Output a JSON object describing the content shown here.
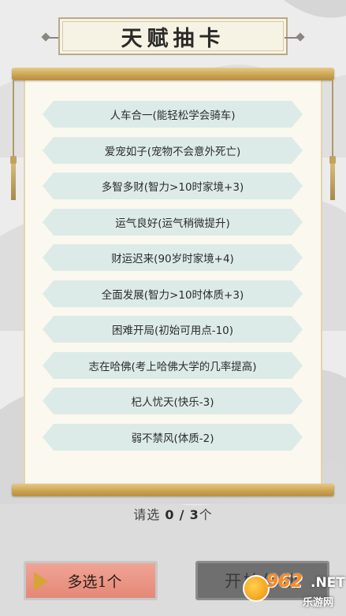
{
  "title": "天赋抽卡",
  "talents": [
    {
      "label": "人车合一(能轻松学会骑车)"
    },
    {
      "label": "爱宠如子(宠物不会意外死亡)"
    },
    {
      "label": "多智多财(智力>10时家境+3)"
    },
    {
      "label": "运气良好(运气稍微提升)"
    },
    {
      "label": "财运迟来(90岁时家境+4)"
    },
    {
      "label": "全面发展(智力>10时体质+3)"
    },
    {
      "label": "困难开局(初始可用点-10)"
    },
    {
      "label": "志在哈佛(考上哈佛大学的几率提高)"
    },
    {
      "label": "杞人忧天(快乐-3)"
    },
    {
      "label": "弱不禁风(体质-2)"
    }
  ],
  "counter": {
    "prefix": "请选",
    "selected": "0",
    "sep": "/",
    "total": "3",
    "suffix": "个"
  },
  "buttons": {
    "multi_label": "多选1个",
    "start_label": "开始修仙"
  },
  "watermark": {
    "number": "962",
    "net": ".NET",
    "site": "乐游网"
  },
  "colors": {
    "accent_gold": "#c9a152",
    "item_fill": "#dcebe8",
    "multi_button": "#e58877",
    "start_button": "#6f6f6f"
  }
}
